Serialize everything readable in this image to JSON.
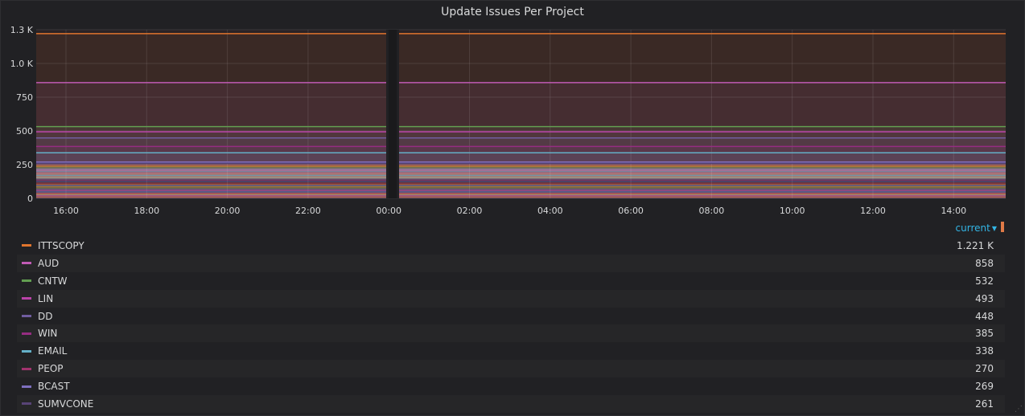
{
  "panel": {
    "title": "Update Issues Per Project"
  },
  "legend": {
    "column_label": "current",
    "items": [
      {
        "name": "ITTSCOPY",
        "value": "1.221 K",
        "color": "#e0752d"
      },
      {
        "name": "AUD",
        "value": "858",
        "color": "#c15bb5"
      },
      {
        "name": "CNTW",
        "value": "532",
        "color": "#629e51"
      },
      {
        "name": "LIN",
        "value": "493",
        "color": "#ba43a9"
      },
      {
        "name": "DD",
        "value": "448",
        "color": "#705da0"
      },
      {
        "name": "WIN",
        "value": "385",
        "color": "#962d82"
      },
      {
        "name": "EMAIL",
        "value": "338",
        "color": "#64b0c8"
      },
      {
        "name": "PEOP",
        "value": "270",
        "color": "#a1336e"
      },
      {
        "name": "BCAST",
        "value": "269",
        "color": "#7e6fbf"
      },
      {
        "name": "SUMVCONE",
        "value": "261",
        "color": "#584477"
      }
    ]
  },
  "chart_data": {
    "type": "area",
    "title": "Update Issues Per Project",
    "x_ticks": [
      "16:00",
      "18:00",
      "20:00",
      "22:00",
      "00:00",
      "02:00",
      "04:00",
      "06:00",
      "08:00",
      "10:00",
      "12:00",
      "14:00"
    ],
    "y_ticks": [
      "0",
      "250",
      "500",
      "750",
      "1.0 K",
      "1.3 K"
    ],
    "ylim": [
      0,
      1250
    ],
    "grid": true,
    "series": [
      {
        "name": "ITTSCOPY",
        "value": 1221,
        "color": "#e0752d"
      },
      {
        "name": "AUD",
        "value": 858,
        "color": "#c15bb5"
      },
      {
        "name": "CNTW",
        "value": 532,
        "color": "#629e51"
      },
      {
        "name": "LIN",
        "value": 493,
        "color": "#ba43a9"
      },
      {
        "name": "DD",
        "value": 448,
        "color": "#705da0"
      },
      {
        "name": "WIN",
        "value": 385,
        "color": "#962d82"
      },
      {
        "name": "EMAIL",
        "value": 338,
        "color": "#64b0c8"
      },
      {
        "name": "PEOP",
        "value": 270,
        "color": "#a1336e"
      },
      {
        "name": "BCAST",
        "value": 269,
        "color": "#7e6fbf"
      },
      {
        "name": "SUMVCONE",
        "value": 261,
        "color": "#584477"
      }
    ]
  }
}
